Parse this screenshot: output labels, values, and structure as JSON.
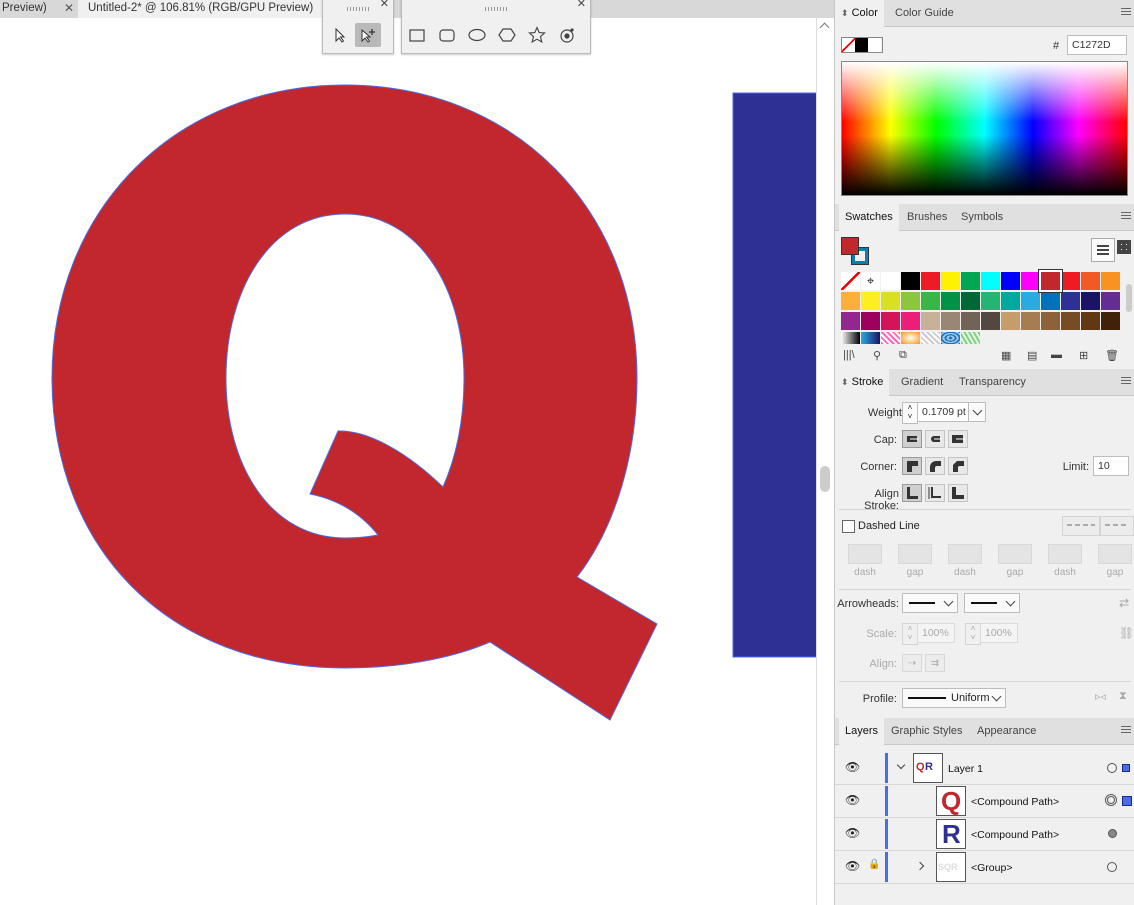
{
  "tabs": [
    {
      "label": "Preview)",
      "active": false
    },
    {
      "label": "Untitled-2* @ 106.81% (RGB/GPU Preview)",
      "active": true
    }
  ],
  "canvas": {
    "letter_q_color": "#C1272D",
    "rectangle_color": "#2E3192",
    "path_outline_color": "#4B6BE8"
  },
  "color_panel": {
    "tabs": [
      "Color",
      "Color Guide"
    ],
    "hex_label": "#",
    "hex_value": "C1272D"
  },
  "swatches_panel": {
    "tabs": [
      "Swatches",
      "Brushes",
      "Symbols"
    ],
    "row1": [
      "#000000",
      "#ED1C24",
      "#FFF200",
      "#00A651",
      "#00FFFF",
      "#0000FF",
      "#FF00FF",
      "#C1272D",
      "#ED1C24",
      "#F15A24",
      "#F7931E"
    ],
    "row2": [
      "#FBB03B",
      "#FCEE21",
      "#D9E021",
      "#8CC63F",
      "#39B54A",
      "#009245",
      "#006837",
      "#22B573",
      "#00A99D",
      "#29ABE2",
      "#0071BC",
      "#2E3192",
      "#1B1464",
      "#662D91"
    ],
    "row3": [
      "#93278F",
      "#9E005D",
      "#D4145A",
      "#ED1E79",
      "#C7B299",
      "#998675",
      "#736357",
      "#534741",
      "#C69C6D",
      "#A67C52",
      "#8C6239",
      "#754C24",
      "#603813",
      "#42210B"
    ]
  },
  "stroke_panel": {
    "tabs": [
      "Stroke",
      "Gradient",
      "Transparency"
    ],
    "weight_label": "Weight:",
    "weight_value": "0.1709 pt",
    "cap_label": "Cap:",
    "corner_label": "Corner:",
    "limit_label": "Limit:",
    "limit_value": "10",
    "align_label": "Align Stroke:",
    "dashed_label": "Dashed Line",
    "dash_labels": [
      "dash",
      "gap",
      "dash",
      "gap",
      "dash",
      "gap"
    ],
    "arrowheads_label": "Arrowheads:",
    "scale_label": "Scale:",
    "scale_start": "100%",
    "scale_end": "100%",
    "align_arrow_label": "Align:",
    "profile_label": "Profile:",
    "profile_value": "Uniform"
  },
  "layers_panel": {
    "tabs": [
      "Layers",
      "Graphic Styles",
      "Appearance"
    ],
    "rows": [
      {
        "name": "Layer 1"
      },
      {
        "name": "<Compound Path>"
      },
      {
        "name": "<Compound Path>"
      },
      {
        "name": "<Group>"
      }
    ]
  }
}
